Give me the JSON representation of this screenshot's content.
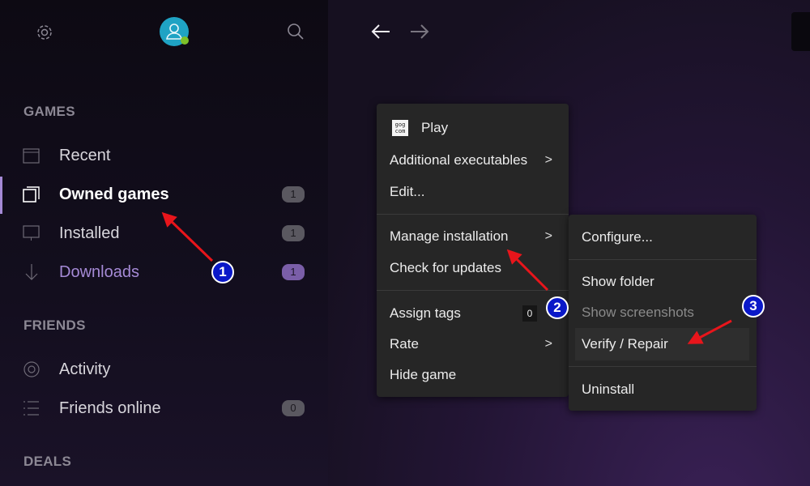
{
  "sidebar": {
    "sections": {
      "games": "GAMES",
      "friends": "FRIENDS",
      "deals": "DEALS"
    },
    "games_items": [
      {
        "label": "Recent",
        "icon": "calendar-icon"
      },
      {
        "label": "Owned games",
        "icon": "stack-icon",
        "badge": "1",
        "active": true
      },
      {
        "label": "Installed",
        "icon": "monitor-icon",
        "badge": "1"
      },
      {
        "label": "Downloads",
        "icon": "download-icon",
        "badge": "1"
      }
    ],
    "friends_items": [
      {
        "label": "Activity",
        "icon": "activity-icon"
      },
      {
        "label": "Friends online",
        "icon": "list-icon",
        "badge": "0"
      }
    ]
  },
  "context_menu": {
    "items": [
      {
        "label": "Play",
        "icon": "gog-logo-icon",
        "logo_text": "gog com"
      },
      {
        "label": "Additional executables",
        "submenu": true
      },
      {
        "label": "Edit..."
      },
      {
        "label": "Manage installation",
        "submenu": true
      },
      {
        "label": "Check for updates"
      },
      {
        "label": "Assign tags",
        "badge": "0"
      },
      {
        "label": "Rate",
        "submenu": true
      },
      {
        "label": "Hide game"
      }
    ]
  },
  "submenu": {
    "items": [
      {
        "label": "Configure..."
      },
      {
        "label": "Show folder"
      },
      {
        "label": "Show screenshots",
        "disabled": true
      },
      {
        "label": "Verify / Repair",
        "highlighted": true
      },
      {
        "label": "Uninstall"
      }
    ]
  },
  "annotations": [
    "1",
    "2",
    "3"
  ],
  "colors": {
    "accent_purple": "#a58ad6",
    "annotation_red": "#e8151b",
    "annotation_blue": "#0a18c8",
    "avatar": "#1fa3c4",
    "online": "#7ec12a"
  }
}
